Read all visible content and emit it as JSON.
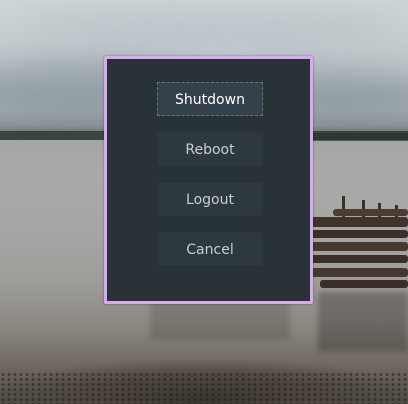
{
  "background": {
    "description": "lake-with-pier-wallpaper"
  },
  "dialog": {
    "border_color": "#d8a9ee",
    "background_color": "#283237",
    "buttons": {
      "shutdown": "Shutdown",
      "reboot": "Reboot",
      "logout": "Logout",
      "cancel": "Cancel"
    },
    "focused_button": "shutdown"
  }
}
